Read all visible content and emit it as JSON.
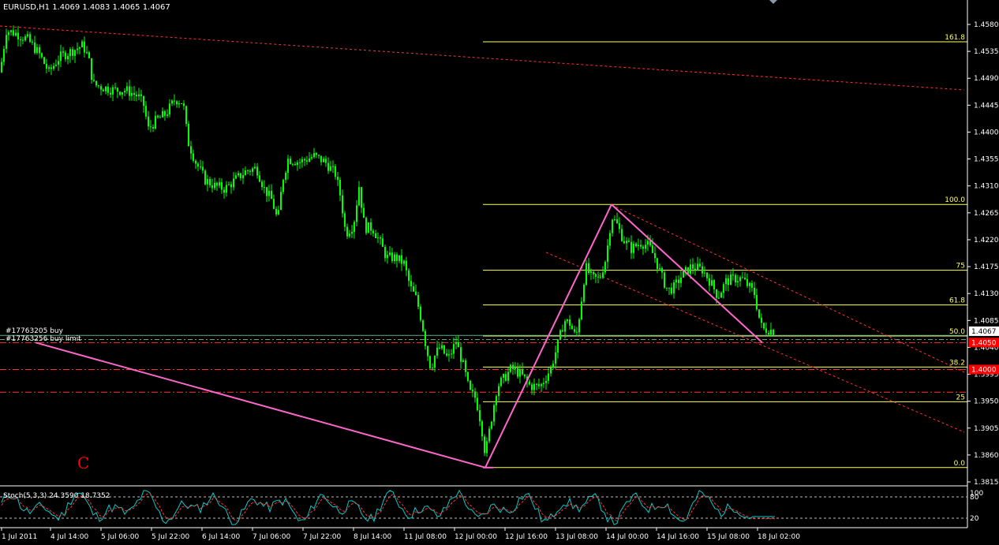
{
  "header": {
    "symbol_line": "EURUSD,H1  1.4069 1.4083 1.4065 1.4067"
  },
  "colors": {
    "background": "#000000",
    "candle": "#00ff00",
    "axis": "#ffffff",
    "fibo": "#ffff66",
    "channel": "#ff3333",
    "zigzag": "#ff66cc",
    "stoch_main": "#00cccc",
    "stoch_signal": "#ff3333",
    "price_tag_current": "#ffffff",
    "price_tag_red": "#ff0000",
    "marker_c": "#ff0000"
  },
  "orders": {
    "buy_label": "#17763205 buy",
    "buy_limit_label": "#17763256 buy limit"
  },
  "marker_c": "C",
  "chart_data": {
    "type": "candlestick",
    "symbol": "EURUSD",
    "timeframe": "H1",
    "ylim": [
      1.3815,
      1.4615
    ],
    "yticks": [
      "1.4580",
      "1.4535",
      "1.4490",
      "1.4445",
      "1.4400",
      "1.4355",
      "1.4310",
      "1.4265",
      "1.4220",
      "1.4175",
      "1.4130",
      "1.4085",
      "1.4040",
      "1.3995",
      "1.3950",
      "1.3905",
      "1.3860",
      "1.3815"
    ],
    "xticks": [
      "1 Jul 2011",
      "4 Jul 14:00",
      "5 Jul 06:00",
      "5 Jul 22:00",
      "6 Jul 14:00",
      "7 Jul 06:00",
      "7 Jul 22:00",
      "8 Jul 14:00",
      "11 Jul 08:00",
      "12 Jul 00:00",
      "12 Jul 16:00",
      "13 Jul 08:00",
      "14 Jul 00:00",
      "14 Jul 16:00",
      "15 Jul 08:00",
      "18 Jul 02:00"
    ],
    "current_price": "1.4067",
    "price_tags": [
      {
        "price": 1.4067,
        "text": "1.4067",
        "kind": "current"
      },
      {
        "price": 1.4048,
        "text": "1.4050",
        "kind": "red"
      },
      {
        "price": 1.4003,
        "text": "1.4000",
        "kind": "red"
      }
    ],
    "path_points": [
      [
        0,
        1.45
      ],
      [
        8,
        1.457
      ],
      [
        20,
        1.4565
      ],
      [
        35,
        1.4555
      ],
      [
        50,
        1.453
      ],
      [
        62,
        1.45
      ],
      [
        75,
        1.4525
      ],
      [
        90,
        1.4535
      ],
      [
        105,
        1.4545
      ],
      [
        112,
        1.4525
      ],
      [
        118,
        1.448
      ],
      [
        130,
        1.4475
      ],
      [
        145,
        1.447
      ],
      [
        160,
        1.447
      ],
      [
        175,
        1.446
      ],
      [
        182,
        1.4445
      ],
      [
        188,
        1.4405
      ],
      [
        198,
        1.442
      ],
      [
        210,
        1.443
      ],
      [
        222,
        1.4455
      ],
      [
        232,
        1.445
      ],
      [
        238,
        1.4385
      ],
      [
        248,
        1.435
      ],
      [
        260,
        1.432
      ],
      [
        272,
        1.431
      ],
      [
        285,
        1.4305
      ],
      [
        298,
        1.432
      ],
      [
        312,
        1.4335
      ],
      [
        325,
        1.434
      ],
      [
        335,
        1.4305
      ],
      [
        345,
        1.4285
      ],
      [
        352,
        1.425
      ],
      [
        358,
        1.432
      ],
      [
        365,
        1.4355
      ],
      [
        380,
        1.435
      ],
      [
        398,
        1.436
      ],
      [
        412,
        1.435
      ],
      [
        425,
        1.433
      ],
      [
        432,
        1.429
      ],
      [
        438,
        1.423
      ],
      [
        448,
        1.4245
      ],
      [
        455,
        1.431
      ],
      [
        462,
        1.424
      ],
      [
        472,
        1.424
      ],
      [
        480,
        1.422
      ],
      [
        490,
        1.419
      ],
      [
        502,
        1.419
      ],
      [
        512,
        1.418
      ],
      [
        520,
        1.414
      ],
      [
        528,
        1.412
      ],
      [
        535,
        1.408
      ],
      [
        540,
        1.404
      ],
      [
        546,
        1.4005
      ],
      [
        552,
        1.403
      ],
      [
        558,
        1.404
      ],
      [
        568,
        1.402
      ],
      [
        578,
        1.405
      ],
      [
        588,
        1.4005
      ],
      [
        595,
        1.3965
      ],
      [
        603,
        1.3955
      ],
      [
        610,
        1.391
      ],
      [
        615,
        1.386
      ],
      [
        622,
        1.3915
      ],
      [
        630,
        1.3975
      ],
      [
        640,
        1.399
      ],
      [
        648,
        1.4005
      ],
      [
        660,
        1.3995
      ],
      [
        672,
        1.3975
      ],
      [
        685,
        1.3975
      ],
      [
        698,
        1.4005
      ],
      [
        708,
        1.405
      ],
      [
        715,
        1.4085
      ],
      [
        722,
        1.408
      ],
      [
        730,
        1.4055
      ],
      [
        736,
        1.411
      ],
      [
        742,
        1.4175
      ],
      [
        750,
        1.4155
      ],
      [
        760,
        1.4155
      ],
      [
        768,
        1.419
      ],
      [
        775,
        1.426
      ],
      [
        782,
        1.4245
      ],
      [
        790,
        1.422
      ],
      [
        800,
        1.4205
      ],
      [
        812,
        1.4215
      ],
      [
        822,
        1.421
      ],
      [
        830,
        1.419
      ],
      [
        838,
        1.416
      ],
      [
        846,
        1.4135
      ],
      [
        854,
        1.414
      ],
      [
        864,
        1.416
      ],
      [
        876,
        1.4175
      ],
      [
        890,
        1.417
      ],
      [
        900,
        1.415
      ],
      [
        910,
        1.4125
      ],
      [
        920,
        1.415
      ],
      [
        930,
        1.4155
      ],
      [
        940,
        1.4155
      ],
      [
        950,
        1.414
      ],
      [
        956,
        1.413
      ],
      [
        962,
        1.409
      ],
      [
        966,
        1.407
      ],
      [
        975,
        1.407
      ],
      [
        982,
        1.4067
      ]
    ],
    "fibonacci": {
      "price_0": 1.3839,
      "price_100": 1.4279,
      "levels": [
        {
          "ratio": 1.618,
          "label": "161.8"
        },
        {
          "ratio": 1.0,
          "label": "100.0"
        },
        {
          "ratio": 0.75,
          "label": "75"
        },
        {
          "ratio": 0.618,
          "label": "61.8"
        },
        {
          "ratio": 0.5,
          "label": "50.0"
        },
        {
          "ratio": 0.382,
          "label": "38.2"
        },
        {
          "ratio": 0.25,
          "label": "25"
        },
        {
          "ratio": 0.0,
          "label": "0.0"
        }
      ]
    },
    "horizontal_levels": [
      {
        "price": 1.406,
        "style": "order-buy"
      },
      {
        "price": 1.4053,
        "style": "order-buy-limit"
      },
      {
        "price": 1.4048,
        "style": "red-dashdot"
      },
      {
        "price": 1.4003,
        "style": "red-dashdot"
      },
      {
        "price": 1.3965,
        "style": "red-dashdot"
      }
    ],
    "stochastic": {
      "label": "Stoch(5,3,3) 24.3590 18.7352",
      "params": "5,3,3",
      "main": 24.359,
      "signal": 18.7352,
      "ylim": [
        0,
        100
      ],
      "levels": [
        {
          "value": 80,
          "label": "80"
        },
        {
          "value": 20,
          "label": "20"
        }
      ],
      "top_label": "100"
    }
  }
}
